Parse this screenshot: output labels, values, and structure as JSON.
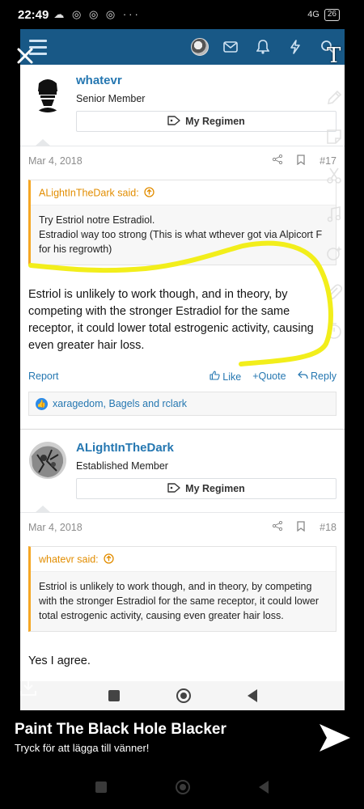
{
  "status": {
    "time": "22:49",
    "indicators": "☁ ◎ ◎ ◎ ···",
    "network": "4G",
    "battery": "26"
  },
  "header": {
    "menu_icon": "hamburger-icon",
    "icons": [
      "avatar",
      "mail-icon",
      "bell-icon",
      "bolt-icon",
      "search-icon"
    ]
  },
  "posts": [
    {
      "user": "whatevr",
      "role": "Senior Member",
      "regimen_label": "My Regimen",
      "date": "Mar 4, 2018",
      "number": "#17",
      "quote_author": "ALightInTheDark said:",
      "quote_lines": [
        "Try Estriol notre Estradiol.",
        "Estradiol way too strong (This is what wthever got via Alpicort F for his regrowth)"
      ],
      "message": "Estriol is unlikely to work though, and in theory, by competing with the stronger Estradiol for the same receptor, it could lower total estrogenic activity, causing even greater hair loss.",
      "report": "Report",
      "like": "Like",
      "quote_btn": "+Quote",
      "reply": "Reply",
      "reactions": "xaragedom, Bagels and rclark"
    },
    {
      "user": "ALightInTheDark",
      "role": "Established Member",
      "regimen_label": "My Regimen",
      "date": "Mar 4, 2018",
      "number": "#18",
      "quote_author": "whatevr said:",
      "quote_text": "Estriol is unlikely to work though, and in theory, by competing with the stronger Estradiol for the same receptor, it could lower total estrogenic activity, causing even greater hair loss.",
      "message": "Yes I agree."
    }
  ],
  "snap": {
    "title": "Paint The Black Hole Blacker",
    "subtitle": "Tryck för att lägga till vänner!",
    "overlay_text_tool": "T"
  },
  "colors": {
    "header_bg": "#185886",
    "link": "#2577b1",
    "quote_accent": "#f5a623",
    "doodle": "#f2ee1b"
  }
}
